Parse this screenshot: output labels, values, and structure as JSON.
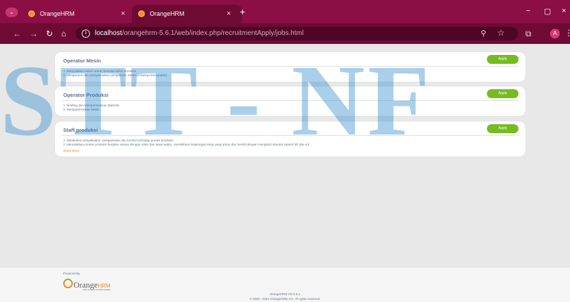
{
  "browser": {
    "tabs": [
      {
        "title": "OrangeHRM",
        "close": "×"
      },
      {
        "title": "OrangeHRM",
        "close": "×"
      }
    ],
    "new_tab": "+",
    "window_controls": {
      "minimize": "−",
      "maximize": "▢",
      "close": "×"
    },
    "url_host": "localhost",
    "url_path": "/orangehrm-5.6.1/web/index.php/recruitmentApply/jobs.html",
    "profile_initial": "A",
    "icons": [
      "tab-search-icon",
      "back-icon",
      "forward-icon",
      "reload-icon",
      "home-icon",
      "site-info-icon",
      "zoom-icon",
      "bookmark-star-icon",
      "extensions-icon",
      "menu-icon"
    ]
  },
  "jobs": [
    {
      "title": "Operator Mesin",
      "description": "1. Menyiapkan mesin untuk memulai siklus produksi\n2. Mengontrol dan menyesuaikan pengaturan mesin (misalnya kecepatan)...",
      "apply_label": "Apply"
    },
    {
      "title": "Operator Produksi",
      "description": "1. Briefing dan Mempersiapkan Material\n2. Mengoperasikan Mesin...",
      "apply_label": "Apply"
    },
    {
      "title": "Staff produksi",
      "description": "1. Melakukan penjadwalan, pengawasan dan kontrol terhadap proses produksi.\n2. Memastikan proses produksi berjalan sesuai dengan order dan tepat waktu, memelihara lingkungan kerja yang aman dan bersih dengan mengikuti standar seperti 5R dan K3...",
      "show_more": "Show More",
      "apply_label": "Apply"
    }
  ],
  "footer": {
    "powered_by": "Powered By",
    "logo_text": "Orange",
    "logo_hrm": "HRM",
    "logo_tagline": "OPEN SOURCE HR MANAGEMENT",
    "version": "OrangeHRM OS 5.6.1",
    "copyright": "© 2005 - 2024 OrangeHRM, Inc. All rights reserved."
  },
  "watermark": {
    "text": "STT - NF"
  },
  "colors": {
    "tabbar": "#8b0e45",
    "toolbar": "#6d0b35",
    "apply_green": "#76bc21",
    "show_more_orange": "#ff7b1d",
    "watermark_blue": "#1e82c8"
  }
}
